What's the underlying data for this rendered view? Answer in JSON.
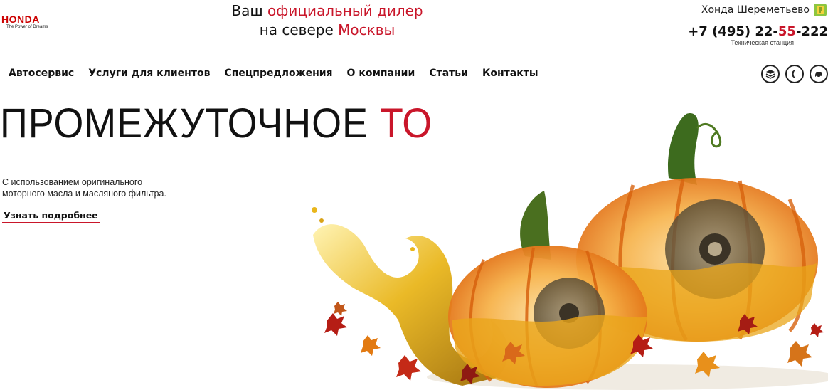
{
  "header": {
    "brand": "HONDA",
    "tagline": "The Power of Dreams",
    "dealer_line1_prefix": "Ваш ",
    "dealer_line1_highlight": "официальный дилер",
    "dealer_line2_prefix": "на севере ",
    "dealer_line2_highlight": "Москвы",
    "dealership_name": "Хонда Шереметьево",
    "phone_main": "+7 (495) 22-",
    "phone_highlight": "55",
    "phone_tail": "-222",
    "phone_caption": "Техническая станция"
  },
  "nav": {
    "items": [
      "Автосервис",
      "Услуги для клиентов",
      "Спецпредложения",
      "О компании",
      "Статьи",
      "Контакты"
    ]
  },
  "tools": [
    "layers-icon",
    "moon-icon",
    "car-icon"
  ],
  "hero": {
    "title_main": "ПРОМЕЖУТОЧНОЕ ",
    "title_highlight": "ТО",
    "description": "С использованием оригинального моторного масла и масляного фильтра.",
    "link_label": "Узнать подробнее"
  },
  "colors": {
    "accent": "#c9162a",
    "pumpkin": "#f08a1c",
    "oil": "#e8b41a"
  }
}
